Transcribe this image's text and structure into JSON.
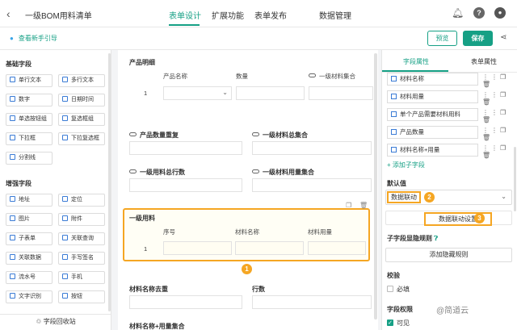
{
  "header": {
    "back_icon": "chevron-left-icon",
    "title": "一级BOM用料清单",
    "tabs": [
      "表单设计",
      "扩展功能",
      "表单发布",
      "数据管理"
    ]
  },
  "toolbar": {
    "guide": "查看新手引导",
    "preview": "预览",
    "save": "保存"
  },
  "left": {
    "basic_title": "基础字段",
    "basic": [
      "单行文本",
      "多行文本",
      "数字",
      "日期时间",
      "单选按钮组",
      "复选框组",
      "下拉框",
      "下拉复选框",
      "分割线"
    ],
    "enhanced_title": "增强字段",
    "enhanced": [
      "地址",
      "定位",
      "图片",
      "附件",
      "子表单",
      "关联查询",
      "关联数据",
      "手写签名",
      "流水号",
      "手机",
      "文字识别",
      "按钮"
    ],
    "recycle": "字段回收站"
  },
  "canvas": {
    "product_detail": "产品明细",
    "product_cols": [
      "产品名称",
      "数量",
      "一级材料集合"
    ],
    "row1": "1",
    "qty_repeat": "产品数量重复",
    "level1_total": "一级材料总集合",
    "level1_rows": "一级用料总行数",
    "level1_qty_set": "一级材料用量集合",
    "subtable_title": "一级用料",
    "sub_cols": [
      "序号",
      "材料名称",
      "材料用量"
    ],
    "badge1": "1",
    "name_dedup": "材料名称去重",
    "row_count": "行数",
    "name_qty_set": "材料名称+用量集合"
  },
  "right": {
    "tab_field": "字段属性",
    "tab_form": "表单属性",
    "sub_fields": [
      "材料名称",
      "材料用量",
      "单个产品需要材料用料",
      "产品数量",
      "材料名称+用量"
    ],
    "add_sub": "+ 添加子字段",
    "default_title": "默认值",
    "default_value": "数据联动",
    "badge2": "2",
    "linkage_setting": "数据联动设置",
    "badge3": "3",
    "hide_rule_title": "子字段显隐规则",
    "add_hide_rule": "添加隐藏规则",
    "validate_title": "校验",
    "required": "必填",
    "perm_title": "字段权限",
    "visible": "可见"
  },
  "watermark": "@简道云",
  "colors": {
    "accent": "#16a085",
    "highlight": "#f5a623"
  }
}
